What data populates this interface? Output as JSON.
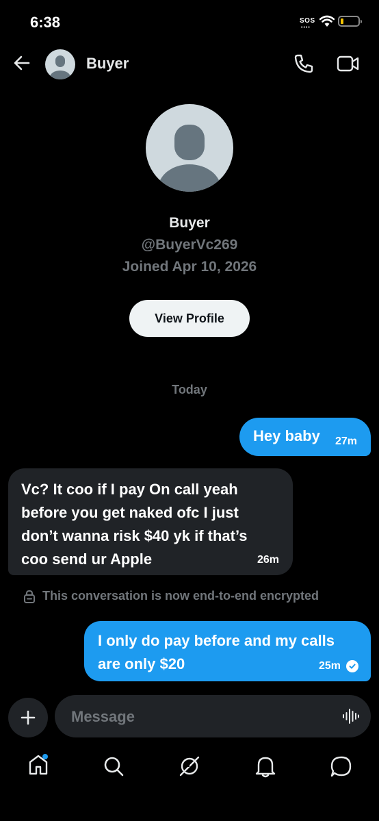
{
  "status_bar": {
    "time": "6:38",
    "sos": "SOS",
    "sos_dots": "••••"
  },
  "header": {
    "name": "Buyer"
  },
  "profile": {
    "name": "Buyer",
    "handle": "@BuyerVc269",
    "joined": "Joined Apr 10, 2026",
    "view_profile_label": "View Profile"
  },
  "date_separator": "Today",
  "messages": [
    {
      "direction": "outgoing",
      "lines": [
        "Hey baby"
      ],
      "time": "27m"
    },
    {
      "direction": "incoming",
      "lines": [
        "Vc? It coo if I pay On call yeah",
        "before you get naked ofc I just",
        "don’t wanna risk $40 yk if that’s",
        "coo send ur Apple"
      ],
      "time": "26m"
    },
    {
      "direction": "outgoing",
      "lines": [
        "I only do pay before and my calls",
        "are only $20"
      ],
      "time": "25m",
      "read": true
    }
  ],
  "encryption_notice": "This conversation is now end-to-end encrypted",
  "composer": {
    "placeholder": "Message"
  },
  "bottom_nav": {
    "items": [
      "home-icon",
      "search-icon",
      "grok-icon",
      "bell-icon",
      "messages-icon"
    ],
    "home_has_badge": true
  },
  "colors": {
    "accent": "#1d9bf0",
    "incoming_bubble": "#202327",
    "muted": "#71767b",
    "background": "#000000"
  }
}
